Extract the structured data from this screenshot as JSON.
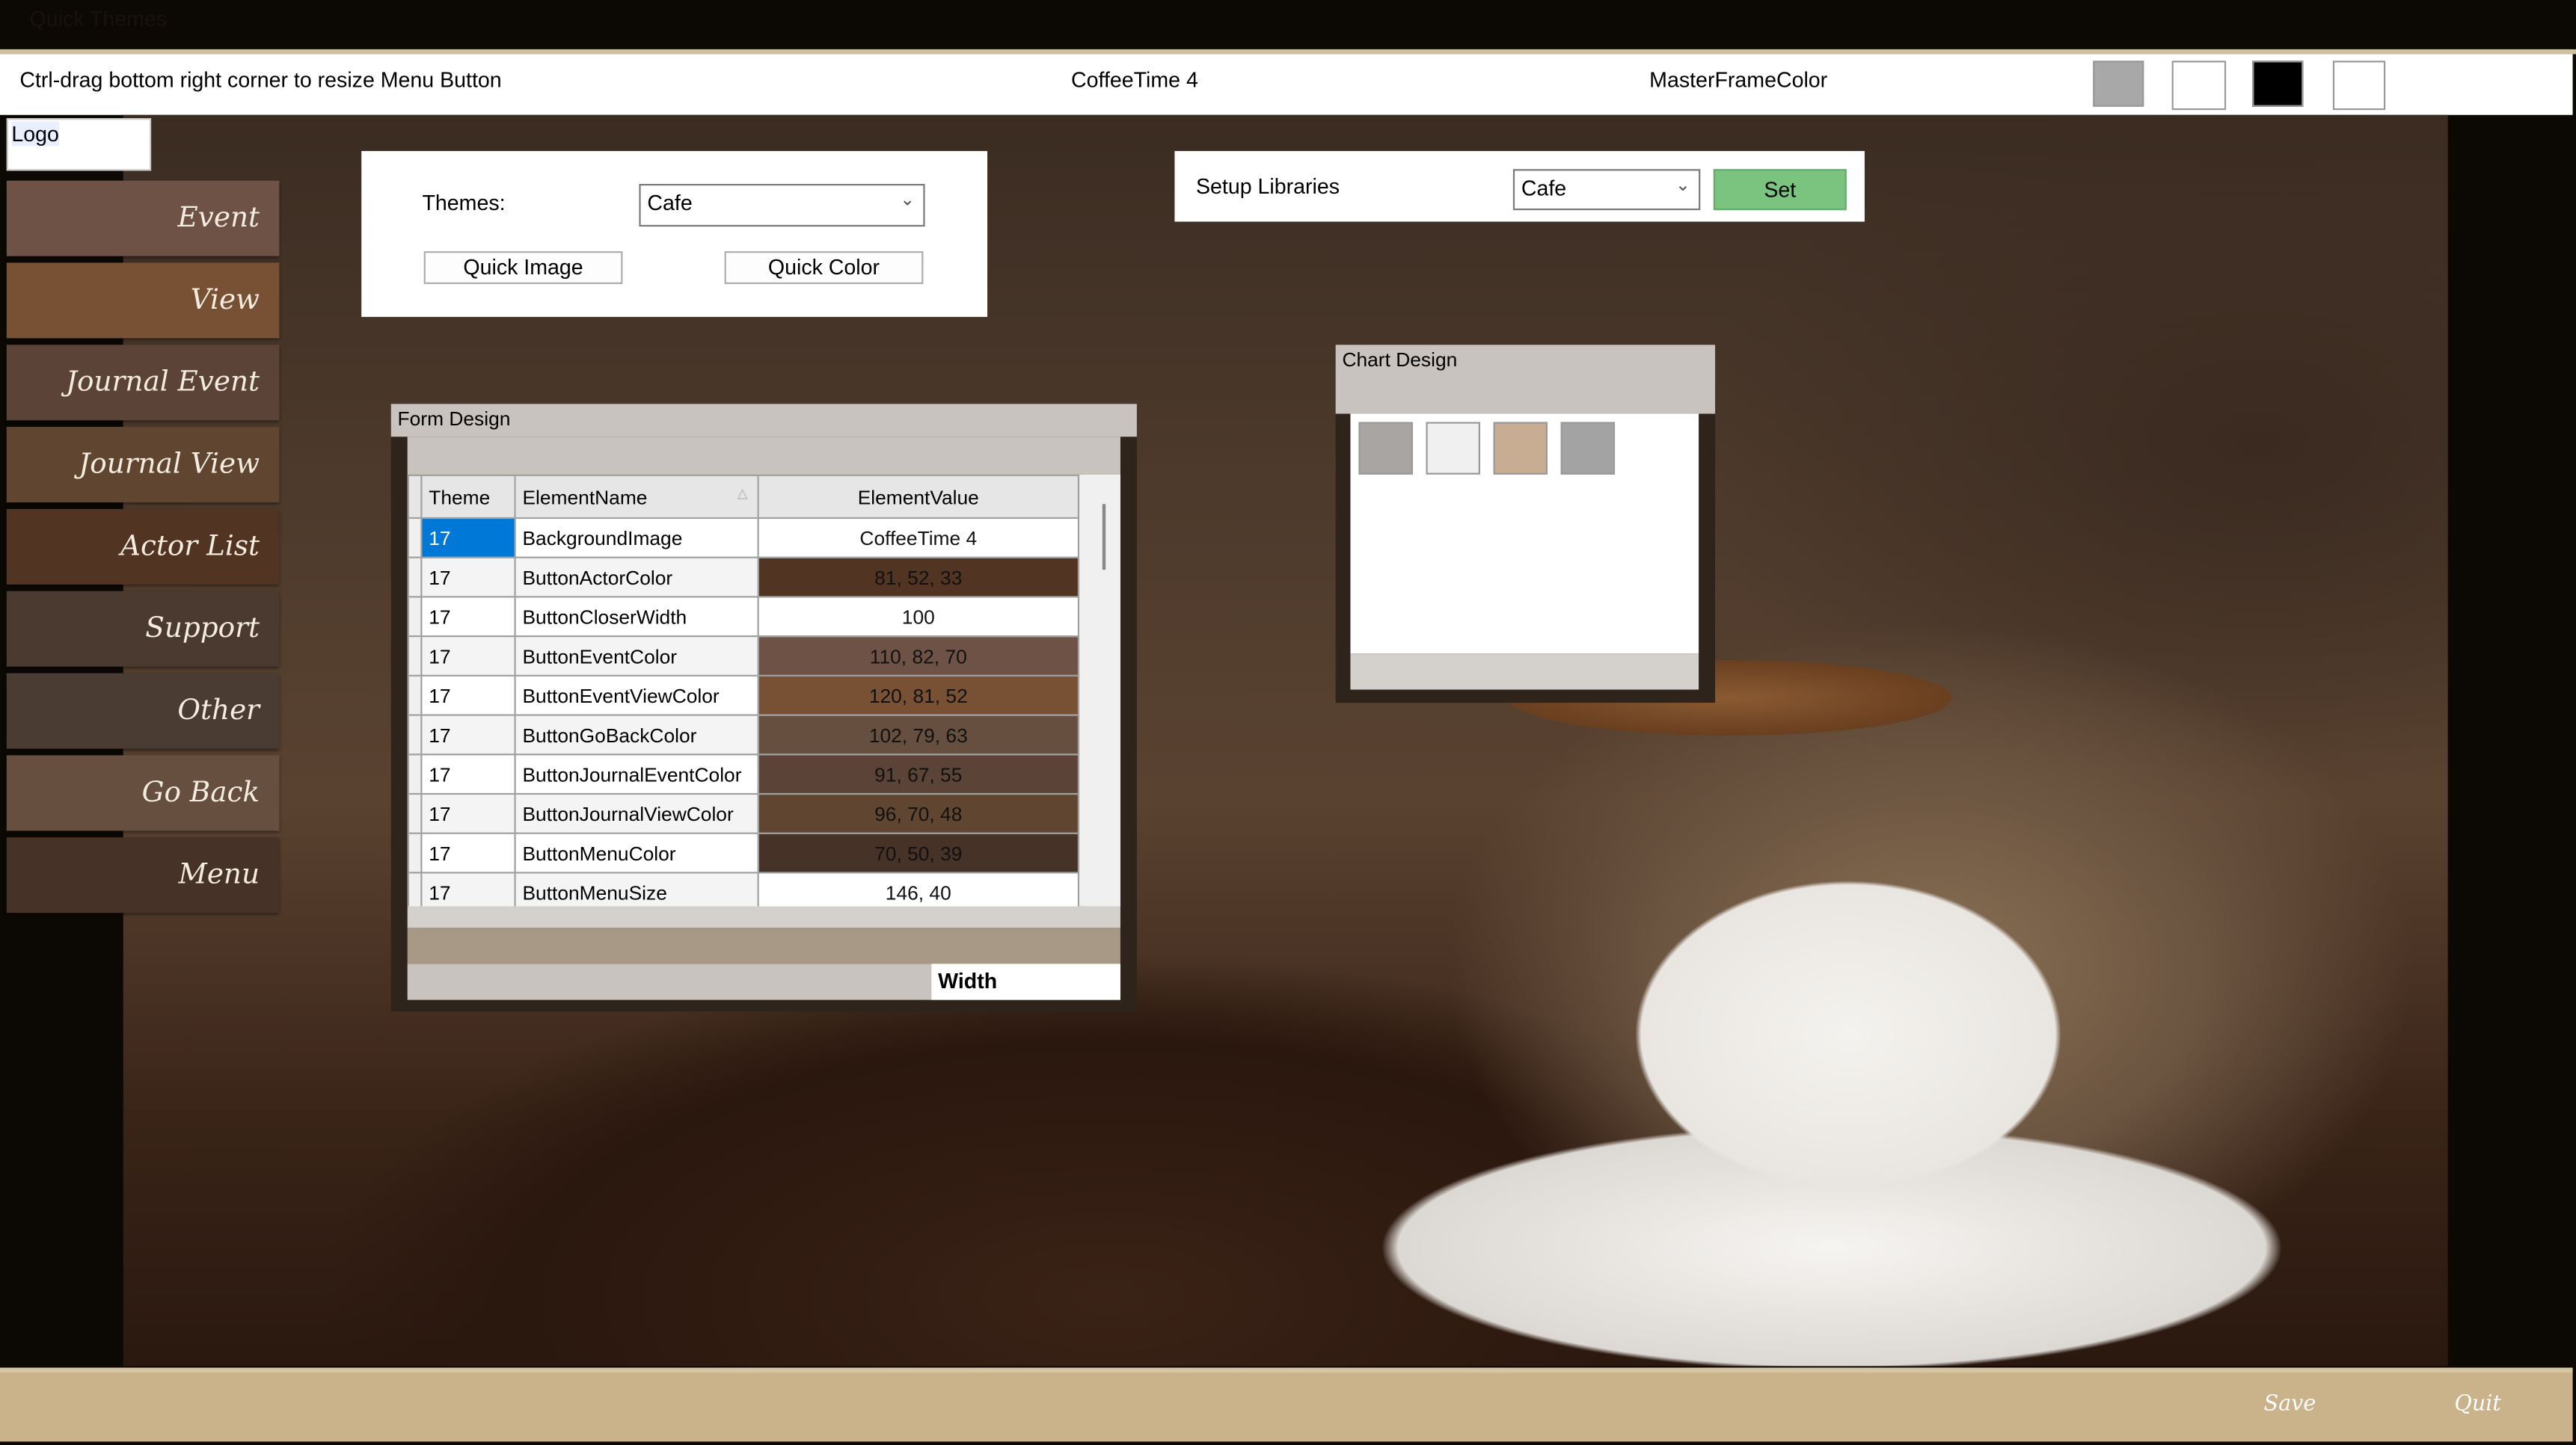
{
  "window": {
    "title": "Quick Themes"
  },
  "topbar": {
    "hint": "Ctrl-drag bottom right corner to resize Menu Button",
    "background_name": "CoffeeTime 4",
    "master_frame_label": "MasterFrameColor",
    "swatches": [
      "#a8a8a8",
      "#ffffff",
      "#000000",
      "#ffffff"
    ]
  },
  "logo": {
    "label": "Logo"
  },
  "menu": [
    {
      "label": "Event",
      "color": "#6e5246"
    },
    {
      "label": "View",
      "color": "#785134"
    },
    {
      "label": "Journal Event",
      "color": "#5b4337"
    },
    {
      "label": "Journal View",
      "color": "#604630"
    },
    {
      "label": "Actor List",
      "color": "#513421"
    },
    {
      "label": "Support",
      "color": "#4a3a30"
    },
    {
      "label": "Other",
      "color": "#4a3b33"
    },
    {
      "label": "Go Back",
      "color": "#664f3f"
    },
    {
      "label": "Menu",
      "color": "#463227"
    }
  ],
  "themes": {
    "label": "Themes:",
    "selected": "Cafe",
    "quick_image": "Quick Image",
    "quick_color": "Quick Color"
  },
  "setup": {
    "label": "Setup Libraries",
    "selected": "Cafe",
    "set": "Set",
    "set_color": "#7ac47f"
  },
  "chart_design": {
    "title": "Chart Design",
    "swatches": [
      "#a9a5a3",
      "#f0f0f0",
      "#c8ad92",
      "#a3a3a3"
    ]
  },
  "form_design": {
    "title": "Form Design",
    "columns": [
      "Theme",
      "ElementName",
      "ElementValue"
    ],
    "rows": [
      {
        "theme": "17",
        "name": "BackgroundImage",
        "value": "CoffeeTime 4",
        "color": "#ffffff"
      },
      {
        "theme": "17",
        "name": "ButtonActorColor",
        "value": "81, 52, 33",
        "color": "#513421"
      },
      {
        "theme": "17",
        "name": "ButtonCloserWidth",
        "value": "100",
        "color": "#ffffff"
      },
      {
        "theme": "17",
        "name": "ButtonEventColor",
        "value": "110, 82, 70",
        "color": "#6e5246"
      },
      {
        "theme": "17",
        "name": "ButtonEventViewColor",
        "value": "120, 81, 52",
        "color": "#785134"
      },
      {
        "theme": "17",
        "name": "ButtonGoBackColor",
        "value": "102, 79, 63",
        "color": "#664f3f"
      },
      {
        "theme": "17",
        "name": "ButtonJournalEventColor",
        "value": "91, 67, 55",
        "color": "#5b4337"
      },
      {
        "theme": "17",
        "name": "ButtonJournalViewColor",
        "value": "96, 70, 48",
        "color": "#604630"
      },
      {
        "theme": "17",
        "name": "ButtonMenuColor",
        "value": "70, 50, 39",
        "color": "#463227"
      },
      {
        "theme": "17",
        "name": "ButtonMenuSize",
        "value": "146, 40",
        "color": "#ffffff"
      }
    ],
    "footer_label": "Width"
  },
  "bottom": {
    "save": "Save",
    "quit": "Quit"
  }
}
